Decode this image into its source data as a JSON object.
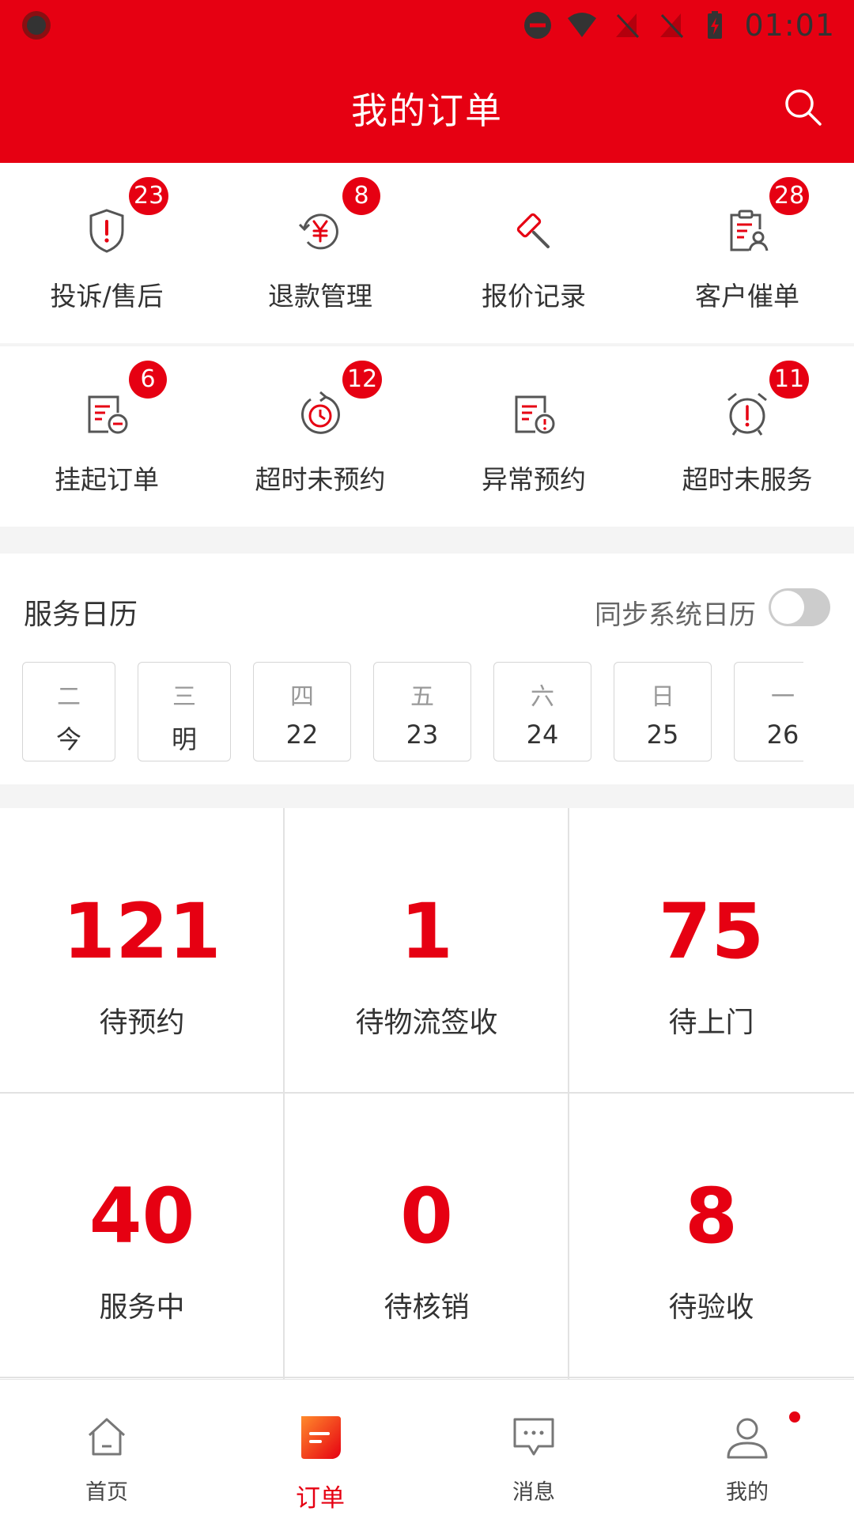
{
  "status_bar": {
    "time": "01:01"
  },
  "header": {
    "title": "我的订单"
  },
  "shortcuts": [
    {
      "label": "投诉/售后",
      "badge": "23",
      "icon": "shield-alert-icon"
    },
    {
      "label": "退款管理",
      "badge": "8",
      "icon": "yuan-refund-icon"
    },
    {
      "label": "报价记录",
      "badge": "",
      "icon": "gavel-icon"
    },
    {
      "label": "客户催单",
      "badge": "28",
      "icon": "clipboard-user-icon"
    },
    {
      "label": "挂起订单",
      "badge": "6",
      "icon": "document-minus-icon"
    },
    {
      "label": "超时未预约",
      "badge": "12",
      "icon": "clock-refresh-icon"
    },
    {
      "label": "异常预约",
      "badge": "",
      "icon": "document-alert-icon"
    },
    {
      "label": "超时未服务",
      "badge": "11",
      "icon": "alarm-alert-icon"
    }
  ],
  "calendar": {
    "title": "服务日历",
    "sync_label": "同步系统日历",
    "sync_enabled": false,
    "days": [
      {
        "weekday": "二",
        "date": "今"
      },
      {
        "weekday": "三",
        "date": "明"
      },
      {
        "weekday": "四",
        "date": "22"
      },
      {
        "weekday": "五",
        "date": "23"
      },
      {
        "weekday": "六",
        "date": "24"
      },
      {
        "weekday": "日",
        "date": "25"
      },
      {
        "weekday": "一",
        "date": "26"
      }
    ]
  },
  "stats": [
    {
      "value": "121",
      "label": "待预约"
    },
    {
      "value": "1",
      "label": "待物流签收"
    },
    {
      "value": "75",
      "label": "待上门"
    },
    {
      "value": "40",
      "label": "服务中"
    },
    {
      "value": "0",
      "label": "待核销"
    },
    {
      "value": "8",
      "label": "待验收"
    }
  ],
  "nav": [
    {
      "label": "首页",
      "icon": "home-icon"
    },
    {
      "label": "订单",
      "icon": "order-icon",
      "active": true
    },
    {
      "label": "消息",
      "icon": "message-icon"
    },
    {
      "label": "我的",
      "icon": "user-icon",
      "dot": true
    }
  ],
  "colors": {
    "brand": "#e60012",
    "text": "#333333",
    "muted": "#999999"
  }
}
